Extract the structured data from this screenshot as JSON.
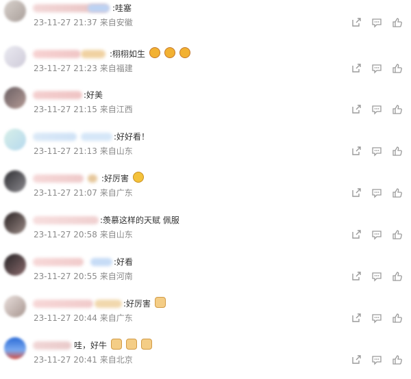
{
  "comments": [
    {
      "text": ":哇塞",
      "time": "23-11-27 21:37",
      "location": "来自安徽"
    },
    {
      "text": ":栩栩如生",
      "time": "23-11-27 21:23",
      "location": "来自福建"
    },
    {
      "text": ":好美",
      "time": "23-11-27 21:15",
      "location": "来自江西"
    },
    {
      "text": ":好好看！",
      "time": "23-11-27 21:13",
      "location": "来自山东"
    },
    {
      "text": ":好厉害",
      "time": "23-11-27 21:07",
      "location": "来自广东"
    },
    {
      "text": ":羡慕这样的天赋 佩服",
      "time": "23-11-27 20:58",
      "location": "来自山东"
    },
    {
      "text": ":好看",
      "time": "23-11-27 20:55",
      "location": "来自河南"
    },
    {
      "text": ":好厉害",
      "time": "23-11-27 20:44",
      "location": "来自广东"
    },
    {
      "text": "哇，好牛",
      "time": "23-11-27 20:41",
      "location": "来自北京"
    }
  ],
  "icons": {
    "share": "share-icon",
    "reply": "comment-icon",
    "like": "thumb-up-icon"
  },
  "colors": {
    "text": "#333333",
    "meta": "#8a8a8a",
    "icon": "#9a9a9a"
  }
}
